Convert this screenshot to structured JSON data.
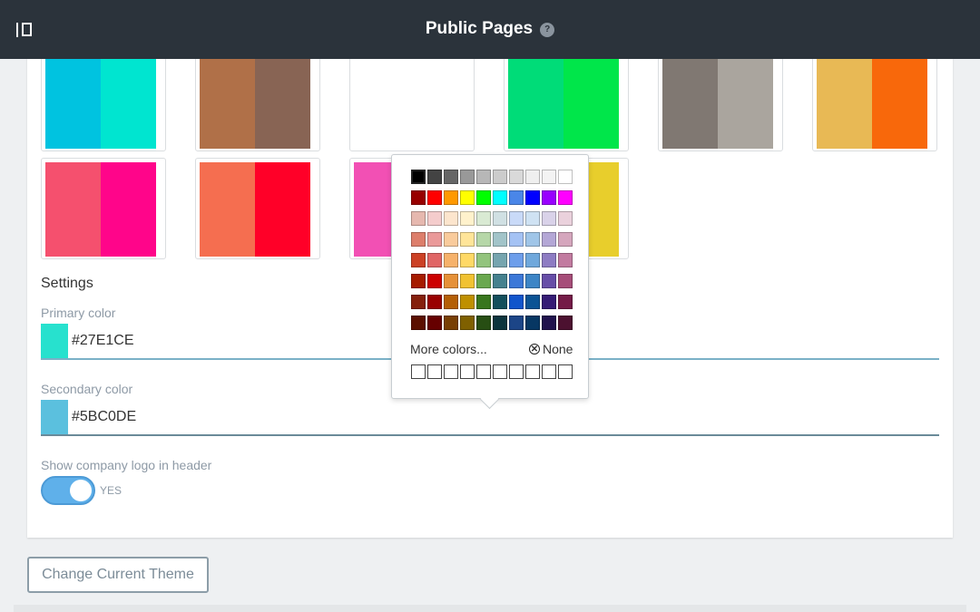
{
  "header": {
    "title": "Public Pages",
    "help_symbol": "?",
    "sidebar_toggle_icon": "sidebar-toggle-icon"
  },
  "themes": [
    {
      "primary": "#00c3e0",
      "secondary": "#00e5d0"
    },
    {
      "primary": "#b07048",
      "secondary": "#886454"
    },
    {
      "primary": "#ffffff",
      "secondary": "#ffffff"
    },
    {
      "primary": "#00dc78",
      "secondary": "#00e64a"
    },
    {
      "primary": "#807872",
      "secondary": "#aaa59e"
    },
    {
      "primary": "#e8b955",
      "secondary": "#f8680b"
    },
    {
      "primary": "#f5506e",
      "secondary": "#ff058a"
    },
    {
      "primary": "#f56e50",
      "secondary": "#ff0028"
    },
    {
      "primary": "#f250b4",
      "secondary": "#f250b4"
    },
    {
      "primary": "#e8ce2c",
      "secondary": "#e8ce2c"
    }
  ],
  "settings": {
    "title": "Settings",
    "primary_label": "Primary color",
    "primary_value": "#27E1CE",
    "primary_color": "#27e1ce",
    "secondary_label": "Secondary color",
    "secondary_value": "#5BC0DE",
    "secondary_color": "#5bc0de",
    "logo_label": "Show company logo in header",
    "logo_toggle_text": "YES"
  },
  "color_picker": {
    "rows": [
      [
        "#000000",
        "#434343",
        "#666666",
        "#999999",
        "#b7b7b7",
        "#cccccc",
        "#d9d9d9",
        "#efefef",
        "#f3f3f3",
        "#ffffff"
      ],
      [
        "#980000",
        "#ff0000",
        "#ff9900",
        "#ffff00",
        "#00ff00",
        "#00ffff",
        "#4a86e8",
        "#0000ff",
        "#9900ff",
        "#ff00ff"
      ],
      [
        "#e6b8af",
        "#f4cccc",
        "#fce5cd",
        "#fff2cc",
        "#d9ead3",
        "#d0e0e3",
        "#c9daf8",
        "#cfe2f3",
        "#d9d2e9",
        "#ead1dc"
      ],
      [
        "#dd7e6b",
        "#ea9999",
        "#f9cb9c",
        "#ffe599",
        "#b6d7a8",
        "#a2c4c9",
        "#a4c2f4",
        "#9fc5e8",
        "#b4a7d6",
        "#d5a6bd"
      ],
      [
        "#cc4125",
        "#e06666",
        "#f6b26b",
        "#ffd966",
        "#93c47d",
        "#76a5af",
        "#6d9eeb",
        "#6fa8dc",
        "#8e7cc3",
        "#c27ba0"
      ],
      [
        "#a61c00",
        "#cc0000",
        "#e69138",
        "#f1c232",
        "#6aa84f",
        "#45818e",
        "#3c78d8",
        "#3d85c6",
        "#674ea7",
        "#a64d79"
      ],
      [
        "#85200c",
        "#990000",
        "#b45f06",
        "#bf9000",
        "#38761d",
        "#134f5c",
        "#1155cc",
        "#0b5394",
        "#351c75",
        "#741b47"
      ],
      [
        "#5b0f00",
        "#660000",
        "#783f04",
        "#7f6000",
        "#274e13",
        "#0c343d",
        "#1c4587",
        "#073763",
        "#20124d",
        "#4c1130"
      ]
    ],
    "more_colors_label": "More colors...",
    "none_label": "None",
    "none_icon": "circle-x-icon",
    "recent_count": 10
  },
  "buttons": {
    "change_theme": "Change Current Theme"
  }
}
